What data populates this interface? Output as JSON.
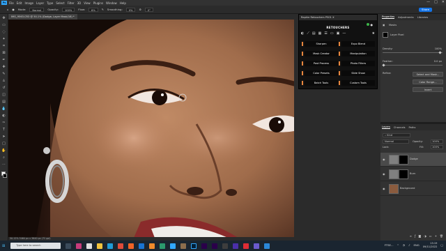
{
  "menubar": {
    "items": [
      "File",
      "Edit",
      "Image",
      "Layer",
      "Type",
      "Select",
      "Filter",
      "3D",
      "View",
      "Plugins",
      "Window",
      "Help"
    ],
    "window_controls": [
      "—",
      "□",
      "✕"
    ]
  },
  "options": {
    "mode_label": "Mode:",
    "mode_value": "Normal",
    "opacity_label": "Opacity:",
    "opacity_value": "100%",
    "flow_label": "Flow:",
    "flow_value": "6%",
    "smoothing_label": "Smoothing:",
    "smoothing_value": "0%",
    "angle_value": "0°",
    "share_label": "Share"
  },
  "document": {
    "tab_title": "IMG_9563.CR3 @ 50.1% (Dodge, Layer Mask/16) *",
    "status": "50.12%   5464 px x 3640 px (72 ppi)"
  },
  "retoucher": {
    "tab_title": "Raphie Retouchers PS01 X",
    "title": "RETOUCHERS",
    "icons": [
      "dodge-tool-icon",
      "brush-tool-icon",
      "layers-icon",
      "grid-icon",
      "list-icon",
      "frame-icon",
      "panel-icon",
      "dash-icon",
      "star-icon"
    ],
    "buttons_left": [
      "Sharpen",
      "Mask Creator",
      "Post Process",
      "Color Presets",
      "Batch Tools"
    ],
    "buttons_right": [
      "Expo Blend",
      "Manipulation",
      "Photo Filters",
      "Slide Show",
      "Custom Tools"
    ],
    "accent": "#e8863d"
  },
  "properties": {
    "tabs": [
      "Properties",
      "Adjustments",
      "Libraries"
    ],
    "section": "Masks",
    "layer_label": "Layer Pixel",
    "density_label": "Density:",
    "density_value": "100%",
    "feather_label": "Feather:",
    "feather_value": "0.0 px",
    "refine_label": "Refine:",
    "buttons": [
      "Select and Mask...",
      "Color Range...",
      "Invert"
    ]
  },
  "layers": {
    "tabs": [
      "Layers",
      "Channels",
      "Paths"
    ],
    "kind_label": "Kind",
    "blend_mode": "Normal",
    "opacity_label": "Opacity:",
    "opacity_value": "100%",
    "lock_label": "Lock:",
    "fill_label": "Fill:",
    "fill_value": "100%",
    "items": [
      {
        "name": "Dodge"
      },
      {
        "name": "Burn"
      },
      {
        "name": "Background"
      }
    ]
  },
  "taskbar": {
    "search_placeholder": "Type here to search",
    "tray_text": "FTSE...",
    "lang": "ENG",
    "time": "13:19",
    "date": "09/11/2022"
  }
}
